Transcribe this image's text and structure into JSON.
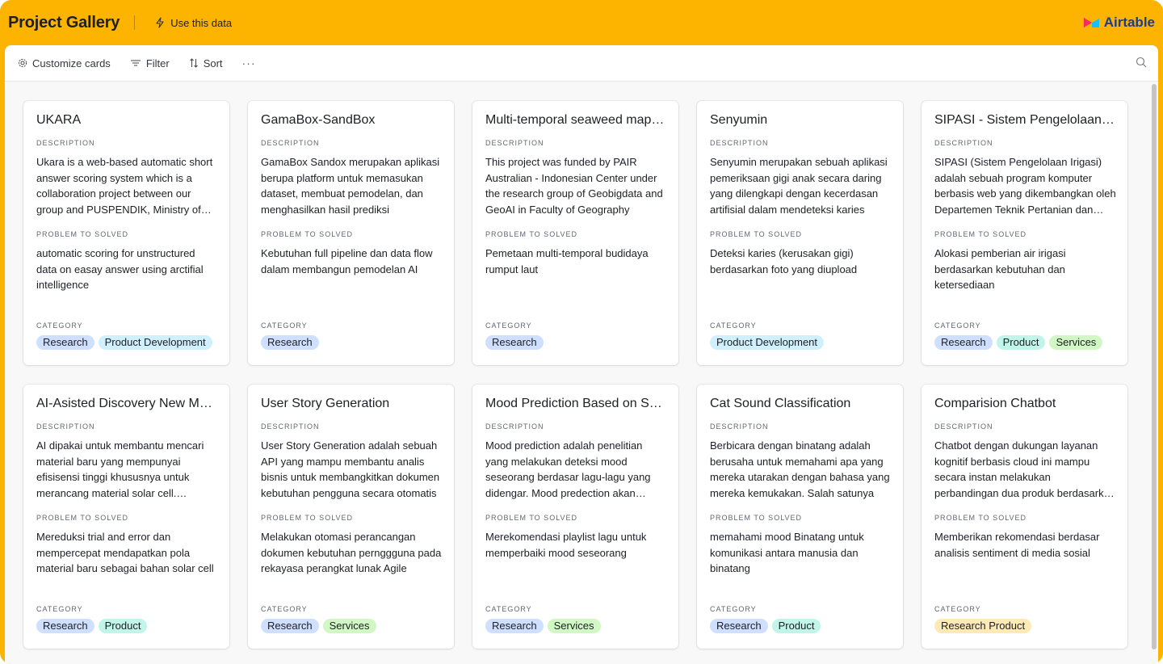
{
  "header": {
    "title": "Project Gallery",
    "use_data_label": "Use this data",
    "brand": "Airtable"
  },
  "toolbar": {
    "customize_label": "Customize cards",
    "filter_label": "Filter",
    "sort_label": "Sort",
    "more_label": "···"
  },
  "labels": {
    "description": "DESCRIPTION",
    "problem": "PROBLEM TO SOLVED",
    "category": "CATEGORY"
  },
  "tag_colors": {
    "Research": "#cfdfff",
    "Product Development": "#d0f0fd",
    "Product": "#c2f5e9",
    "Services": "#d1f7c4",
    "Research Product": "#ffeab6"
  },
  "cards": [
    {
      "title": "UKARA",
      "description": "Ukara is a web-based automatic short answer scoring system which is a collaboration project between our group and PUSPENDIK, Ministry of Education and Culture",
      "problem": "automatic scoring for unstructured data on easay answer using arctifial intelligence",
      "tags": [
        "Research",
        "Product Development"
      ]
    },
    {
      "title": "GamaBox-SandBox",
      "description": "GamaBox Sandox merupakan aplikasi berupa platform untuk memasukan dataset, membuat pemodelan, dan menghasilkan hasil prediksi",
      "problem": "Kebutuhan full pipeline dan data flow dalam membangun pemodelan AI",
      "tags": [
        "Research"
      ]
    },
    {
      "title": "Multi-temporal seaweed mapping",
      "description": "This project was funded by PAIR Australian - Indonesian Center under the research group of Geobigdata and GeoAI in Faculty of Geography",
      "problem": "Pemetaan multi-temporal budidaya rumput laut",
      "tags": [
        "Research"
      ]
    },
    {
      "title": "Senyumin",
      "description": "Senyumin merupakan sebuah aplikasi pemeriksaan gigi anak secara daring yang dilengkapi dengan kecerdasan artifisial dalam mendeteksi karies",
      "problem": "Deteksi karies (kerusakan gigi) berdasarkan foto yang diupload",
      "tags": [
        "Product Development"
      ]
    },
    {
      "title": "SIPASI - Sistem Pengelolaan Irigasi",
      "description": "SIPASI (Sistem Pengelolaan Irigasi) adalah sebuah program komputer berbasis web yang dikembangkan oleh Departemen Teknik Pertanian dan Biosistem",
      "problem": "Alokasi pemberian air irigasi berdasarkan kebutuhan dan ketersediaan",
      "tags": [
        "Research",
        "Product",
        "Services"
      ]
    },
    {
      "title": "AI-Asisted Discovery New Material",
      "description": "AI dipakai untuk membantu mencari material baru yang mempunyai efisisensi tinggi khususnya untuk merancang material solar cell. Pendekatan ini",
      "problem": "Mereduksi trial and error dan mempercepat mendapatkan pola material baru sebagai bahan solar cell",
      "tags": [
        "Research",
        "Product"
      ]
    },
    {
      "title": "User Story Generation",
      "description": "User Story Generation adalah sebuah API yang mampu membantu analis bisnis untuk membangkitkan dokumen kebutuhan pengguna secara otomatis",
      "problem": "Melakukan otomasi perancangan dokumen kebutuhan pernggguna pada rekayasa perangkat lunak Agile",
      "tags": [
        "Research",
        "Services"
      ]
    },
    {
      "title": "Mood Prediction Based on Song",
      "description": "Mood prediction adalah penelitian yang melakukan deteksi mood seseorang berdasar lagu-lagu yang didengar. Mood predection akan digunakan",
      "problem": "Merekomendasi playlist lagu untuk memperbaiki mood seseorang",
      "tags": [
        "Research",
        "Services"
      ]
    },
    {
      "title": "Cat Sound Classification",
      "description": "Berbicara dengan binatang adalah berusaha untuk memahami apa yang mereka utarakan dengan bahasa yang mereka kemukakan. Salah satunya",
      "problem": "memahami mood Binatang untuk komunikasi antara manusia dan binatang",
      "tags": [
        "Research",
        "Product"
      ]
    },
    {
      "title": "Comparision Chatbot",
      "description": "Chatbot dengan dukungan layanan kognitif berbasis cloud ini mampu secara instan melakukan perbandingan dua produk berdasarkan ulasan",
      "problem": "Memberikan rekomendasi berdasar analisis sentiment di media sosial",
      "tags": [
        "Research Product"
      ]
    }
  ]
}
